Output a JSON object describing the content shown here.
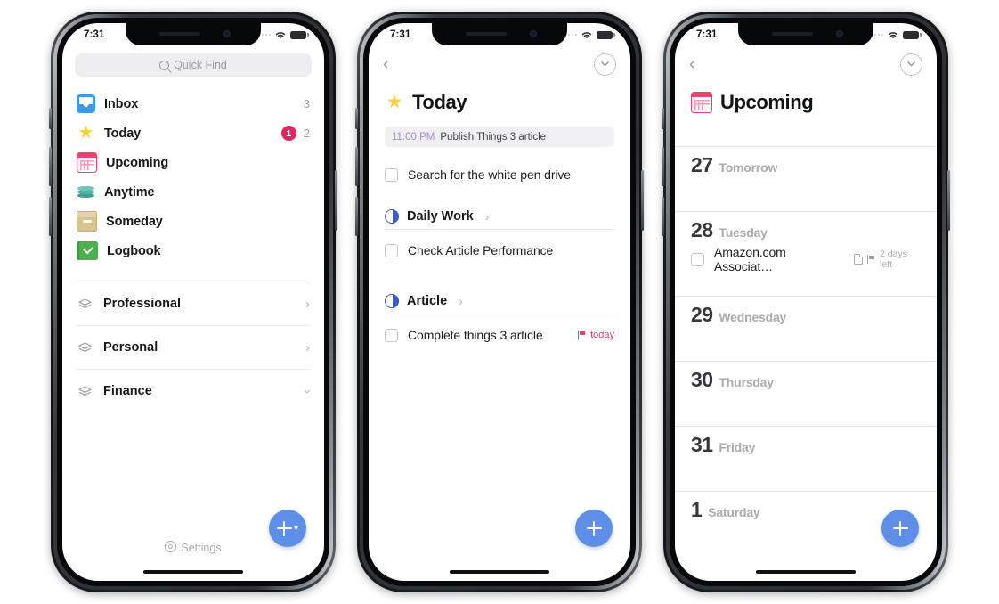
{
  "meta": {
    "app": "Things 3",
    "colors": {
      "accent_blue": "#5d8fe8",
      "badge_pink": "#e6235c",
      "flag_red": "#e8436e",
      "star_yellow": "#f7cf3f",
      "project_blue": "#3c5ccc",
      "event_purple": "#a98cc9"
    }
  },
  "statusbar": {
    "time": "7:31",
    "signal_icon": "signal-dots-icon",
    "wifi_icon": "wifi-icon",
    "battery_icon": "battery-icon"
  },
  "phone1": {
    "search": {
      "placeholder": "Quick Find",
      "icon": "search-icon"
    },
    "nav": [
      {
        "label": "Inbox",
        "icon": "inbox-icon",
        "count": "3",
        "badge": null
      },
      {
        "label": "Today",
        "icon": "star-icon",
        "count": "2",
        "badge": "1"
      },
      {
        "label": "Upcoming",
        "icon": "calendar-icon",
        "count": null,
        "badge": null
      },
      {
        "label": "Anytime",
        "icon": "layers-icon",
        "count": null,
        "badge": null
      },
      {
        "label": "Someday",
        "icon": "box-icon",
        "count": null,
        "badge": null
      },
      {
        "label": "Logbook",
        "icon": "logbook-icon",
        "count": null,
        "badge": null
      }
    ],
    "areas": [
      {
        "label": "Professional",
        "icon": "area-icon",
        "chevron": "chevron-right-icon"
      },
      {
        "label": "Personal",
        "icon": "area-icon",
        "chevron": "chevron-right-icon"
      },
      {
        "label": "Finance",
        "icon": "area-icon",
        "chevron": "chevron-down-icon"
      }
    ],
    "settings": {
      "label": "Settings",
      "icon": "gear-icon"
    },
    "fab": {
      "icon": "plus-icon",
      "chevron": "chevron-down-icon"
    }
  },
  "phone2": {
    "back_icon": "chevron-left-icon",
    "collapse_icon": "chevron-down-circle-icon",
    "title": "Today",
    "title_icon": "star-icon",
    "event": {
      "time": "11:00 PM",
      "title": "Publish Things 3 article"
    },
    "ungrouped_todos": [
      {
        "title": "Search for the white pen drive",
        "checkbox": "checkbox-icon"
      }
    ],
    "projects": [
      {
        "name": "Daily Work",
        "icon": "project-progress-icon",
        "chevron": "chevron-right-icon",
        "todos": [
          {
            "title": "Check Article Performance",
            "tag": null,
            "tag_icon": null
          }
        ]
      },
      {
        "name": "Article",
        "icon": "project-progress-icon",
        "chevron": "chevron-right-icon",
        "todos": [
          {
            "title": "Complete things 3 article",
            "tag": "today",
            "tag_icon": "flag-icon"
          }
        ]
      }
    ],
    "fab": {
      "icon": "plus-icon"
    }
  },
  "phone3": {
    "back_icon": "chevron-left-icon",
    "collapse_icon": "chevron-down-circle-icon",
    "title": "Upcoming",
    "title_icon": "calendar-icon",
    "days": [
      {
        "num": "27",
        "name": "Tomorrow",
        "todos": []
      },
      {
        "num": "28",
        "name": "Tuesday",
        "todos": [
          {
            "title": "Amazon.com Associat…",
            "note_icon": "document-icon",
            "flag_icon": "flag-icon",
            "meta": "2 days left"
          }
        ]
      },
      {
        "num": "29",
        "name": "Wednesday",
        "todos": []
      },
      {
        "num": "30",
        "name": "Thursday",
        "todos": []
      },
      {
        "num": "31",
        "name": "Friday",
        "todos": []
      },
      {
        "num": "1",
        "name": "Saturday",
        "todos": []
      }
    ],
    "fab": {
      "icon": "plus-icon"
    }
  }
}
